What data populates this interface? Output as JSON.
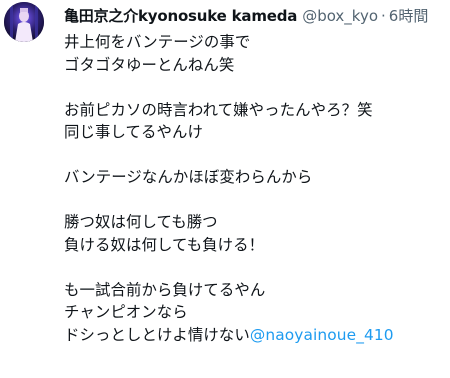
{
  "tweet": {
    "display_name": "亀田京之介kyonosuke kameda",
    "handle": "@box_kyo",
    "separator": "·",
    "time": "6時間",
    "lines": [
      "井上何をバンテージの事で",
      "ゴタゴタゆーとんねん笑",
      "",
      "お前ピカソの時言われて嫌やったんやろ？笑",
      "同じ事してるやんけ",
      "",
      "バンテージなんかほぼ変わらんから",
      "",
      "勝つ奴は何しても勝つ",
      "負ける奴は何しても負ける！",
      "",
      "も一試合前から負けてるやん",
      "チャンピオンなら"
    ],
    "last_line_text": "ドシっとしとけよ情けない",
    "mention": "@naoyainoue_410"
  },
  "colors": {
    "text": "#0f1419",
    "secondary": "#536471",
    "link": "#1d9bf0"
  }
}
